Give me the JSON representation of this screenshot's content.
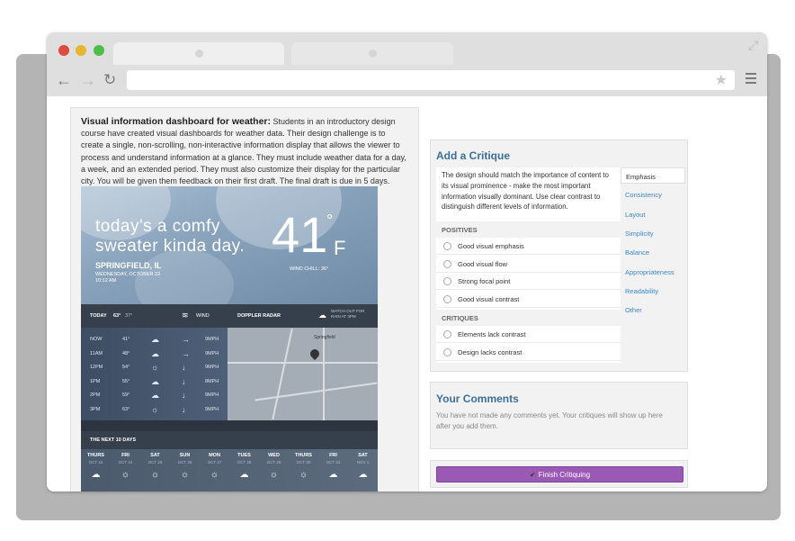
{
  "description": {
    "title": "Visual information dashboard for weather:",
    "body": "Students in an introductory design course have created visual dashboards for weather data. Their design challenge is to create a single, non-scrolling, non-interactive information display that allows the viewer to process and understand information at a glance. They must include weather data for a day, a week, and an extended period. They must also customize their display for the particular city. You will be given them feedback on their first draft. The final draft is due in 5 days."
  },
  "weather": {
    "tagline_1": "today's a comfy",
    "tagline_2": "sweater kinda day.",
    "temp": "41",
    "degree": "°",
    "unit": "F",
    "city": "SPRINGFIELD, IL",
    "date": "WEDNESDAY, OCTOBER 22",
    "time": "10:12 AM",
    "wind_chill": "WIND CHILL: 36°",
    "today_label": "TODAY",
    "today_hi": "63°",
    "today_lo": "37°",
    "wind_label": "WIND",
    "radar_label": "DOPPLER RADAR",
    "radar_note": "WATCH OUT FOR RAIN AT 3PM",
    "map_label": "Springfield",
    "hours": [
      {
        "time": "NOW",
        "temp": "41°",
        "icon": "cloud",
        "wind": "→",
        "speed": "9MPH"
      },
      {
        "time": "11AM",
        "temp": "48°",
        "icon": "cloud",
        "wind": "→",
        "speed": "9MPH"
      },
      {
        "time": "12PM",
        "temp": "54°",
        "icon": "sun",
        "wind": "↓",
        "speed": "9MPH"
      },
      {
        "time": "1PM",
        "temp": "55°",
        "icon": "cloud",
        "wind": "↓",
        "speed": "8MPH"
      },
      {
        "time": "2PM",
        "temp": "59°",
        "icon": "cloud",
        "wind": "↓",
        "speed": "9MPH"
      },
      {
        "time": "3PM",
        "temp": "63°",
        "icon": "sun",
        "wind": "↓",
        "speed": "9MPH"
      }
    ],
    "next_label": "THE NEXT 10 DAYS",
    "days": [
      {
        "day": "THURS",
        "date": "OCT 23",
        "icon": "☁"
      },
      {
        "day": "FRI",
        "date": "OCT 24",
        "icon": "☼"
      },
      {
        "day": "SAT",
        "date": "OCT 25",
        "icon": "☼"
      },
      {
        "day": "SUN",
        "date": "OCT 26",
        "icon": "☼"
      },
      {
        "day": "MON",
        "date": "OCT 27",
        "icon": "☼"
      },
      {
        "day": "TUES",
        "date": "OCT 28",
        "icon": "☁"
      },
      {
        "day": "WED",
        "date": "OCT 29",
        "icon": "☼"
      },
      {
        "day": "THURS",
        "date": "OCT 30",
        "icon": "☼"
      },
      {
        "day": "FRI",
        "date": "OCT 31",
        "icon": "☁"
      },
      {
        "day": "SAT",
        "date": "NOV 1",
        "icon": "☁"
      }
    ]
  },
  "critique": {
    "heading": "Add a Critique",
    "intro": "The design should match the importance of content to its visual prominence - make the most important information visually dominant. Use clear contrast to distinguish different levels of information.",
    "positives_label": "POSITIVES",
    "positives": [
      "Good visual emphasis",
      "Good visual flow",
      "Strong focal point",
      "Good visual contrast"
    ],
    "critiques_label": "CRITIQUES",
    "critiques": [
      "Elements lack contrast",
      "Design lacks contrast"
    ],
    "categories": [
      "Emphasis",
      "Consistency",
      "Layout",
      "Simplicity",
      "Balance",
      "Appropriateness",
      "Readability",
      "Other"
    ]
  },
  "comments": {
    "heading": "Your Comments",
    "empty": "You have not made any comments yet. Your critiques will show up here after you add them."
  },
  "finish": {
    "label": "Finish Critiquing"
  },
  "colors": {
    "accent": "#9b59b6",
    "link": "#3a88c8",
    "heading": "#3d6e95"
  }
}
